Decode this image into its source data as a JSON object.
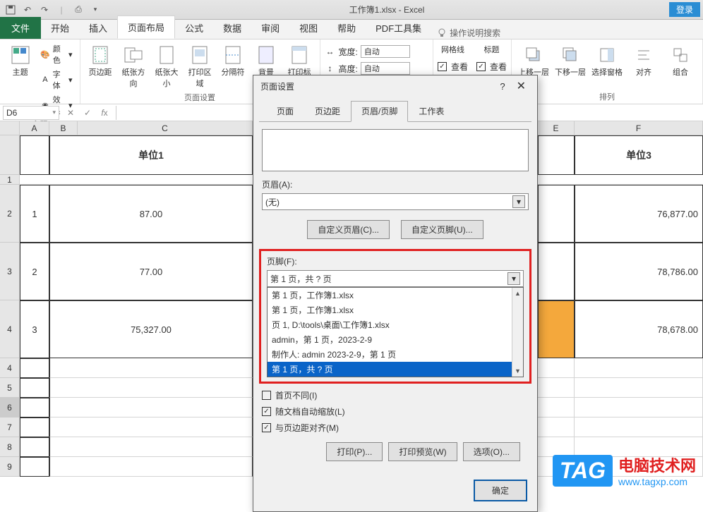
{
  "title": "工作簿1.xlsx - Excel",
  "login": "登录",
  "menu": {
    "file": "文件",
    "home": "开始",
    "insert": "插入",
    "page_layout": "页面布局",
    "formulas": "公式",
    "data": "数据",
    "review": "审阅",
    "view": "视图",
    "help": "帮助",
    "pdf": "PDF工具集",
    "tell_me": "操作说明搜索"
  },
  "ribbon": {
    "themes": {
      "label": "主题",
      "btn": "主题",
      "colors": "颜色",
      "fonts": "字体",
      "effects": "效果"
    },
    "page_setup": {
      "label": "页面设置",
      "margins": "页边距",
      "orientation": "纸张方向",
      "size": "纸张大小",
      "print_area": "打印区域",
      "breaks": "分隔符",
      "background": "背景",
      "print_titles": "打印标题"
    },
    "scale": {
      "width_lbl": "宽度:",
      "height_lbl": "高度:",
      "auto": "自动"
    },
    "sheet_opts": {
      "gridlines": "网格线",
      "headings": "标题",
      "view": "查看",
      "print": "查看"
    },
    "arrange": {
      "label": "排列",
      "bring_fwd": "上移一层",
      "send_back": "下移一层",
      "selection": "选择窗格",
      "align": "对齐",
      "group": "组合"
    }
  },
  "cell_ref": "D6",
  "sheet": {
    "header_unit1": "单位1",
    "header_unit3": "单位3",
    "rows": [
      {
        "num": "1",
        "c": "87.00",
        "f": "76,877.00"
      },
      {
        "num": "2",
        "c": "77.00",
        "f": "78,786.00"
      },
      {
        "num": "3",
        "c": "75,327.00",
        "f": "78,678.00"
      }
    ],
    "small_rows": [
      "4",
      "5",
      "6",
      "7",
      "8",
      "9"
    ]
  },
  "dialog": {
    "title": "页面设置",
    "tabs": {
      "page": "页面",
      "margins": "页边距",
      "header_footer": "页眉/页脚",
      "sheet": "工作表"
    },
    "header_label": "页眉(A):",
    "header_value": "(无)",
    "custom_header": "自定义页眉(C)...",
    "custom_footer": "自定义页脚(U)...",
    "footer_label": "页脚(F):",
    "footer_value": "第 1 页，共 ? 页",
    "footer_options": [
      "第 1 页，工作簿1.xlsx",
      "第 1 页，工作簿1.xlsx",
      "页 1, D:\\tools\\桌面\\工作簿1.xlsx",
      "admin，第 1 页，2023-2-9",
      "制作人: admin 2023-2-9，第 1 页",
      "第 1 页，共 ? 页"
    ],
    "diff_first": "首页不同(I)",
    "scale_doc": "随文档自动缩放(L)",
    "align_margin": "与页边距对齐(M)",
    "print": "打印(P)...",
    "preview": "打印预览(W)",
    "options": "选项(O)...",
    "ok": "确定"
  },
  "tag": {
    "badge": "TAG",
    "site": "电脑技术网",
    "url": "www.tagxp.com"
  }
}
